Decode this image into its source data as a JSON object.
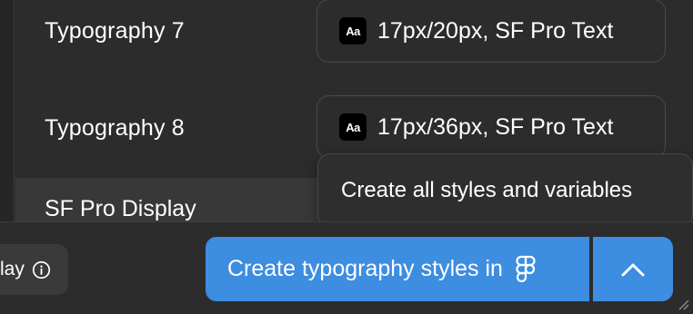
{
  "rows": [
    {
      "label": "Typography 7",
      "chip": "17px/20px, SF Pro Text"
    },
    {
      "label": "Typography 8",
      "chip": "17px/36px, SF Pro Text"
    }
  ],
  "aa_icon_text": "Aa",
  "group": {
    "label": "SF Pro Display"
  },
  "dropdown": {
    "item": "Create all styles and variables"
  },
  "footer": {
    "display_label": "lay",
    "primary_button": "Create typography styles in"
  },
  "colors": {
    "accent": "#3d8de0",
    "background": "#2c2c2c",
    "chip_border": "#4a4a4a"
  },
  "icons": {
    "style": "text-style-icon",
    "info": "info-icon",
    "brand": "figma-icon",
    "chevron": "chevron-up-icon"
  }
}
